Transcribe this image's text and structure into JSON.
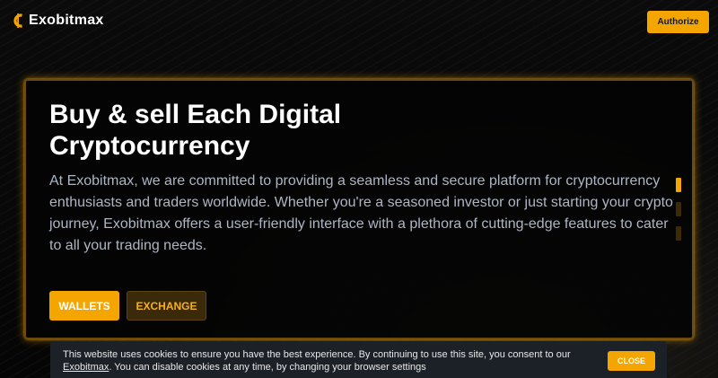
{
  "brand": {
    "name": "Exobitmax",
    "logo_icon": "exobitmax-logo-icon",
    "accent_color": "#f5a500"
  },
  "header": {
    "authorize_label": "Authorize"
  },
  "hero": {
    "title": "Buy & sell Each Digital Cryptocurrency",
    "description": "At Exobitmax, we are committed to providing a seamless and secure platform for cryptocurrency enthusiasts and traders worldwide. Whether you're a seasoned investor or just starting your crypto journey, Exobitmax offers a user-friendly interface with a plethora of cutting-edge features to cater to all your trading needs.",
    "wallets_label": "WALLETS",
    "exchange_label": "EXCHANGE",
    "slides": 3,
    "active_slide": 1
  },
  "cookie_banner": {
    "text_before_link": "This website uses cookies to ensure you have the best experience. By continuing to use this site, you consent to our ",
    "link_text": "Exobitmax",
    "text_after_link": ". You can disable cookies at any time, by changing your browser settings",
    "close_label": "CLOSE"
  }
}
